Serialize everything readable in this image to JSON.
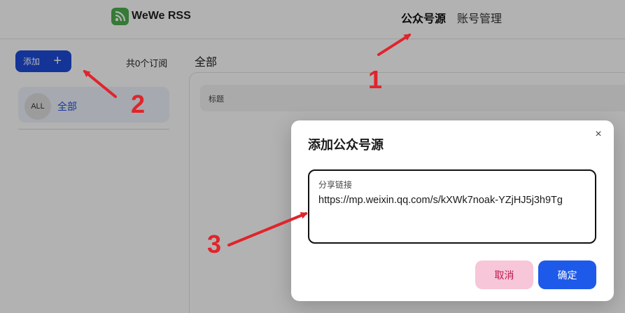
{
  "header": {
    "app_name": "WeWe RSS",
    "nav": [
      {
        "label": "公众号源",
        "active": true
      },
      {
        "label": "账号管理",
        "active": false
      }
    ]
  },
  "sidebar": {
    "add_button_label": "添加",
    "add_icon": "+",
    "subscription_count": "共0个订阅",
    "items": [
      {
        "avatar_text": "ALL",
        "label": "全部"
      }
    ]
  },
  "main": {
    "title": "全部",
    "table_header": "标题"
  },
  "dialog": {
    "title": "添加公众号源",
    "close_icon": "×",
    "field_label": "分享链接",
    "field_value": "https://mp.weixin.qq.com/s/kXWk7noak-YZjHJ5j3h9Tg",
    "cancel_label": "取消",
    "confirm_label": "确定"
  },
  "annotations": {
    "color": "#e0242b",
    "labels": [
      "1",
      "2",
      "3"
    ]
  }
}
